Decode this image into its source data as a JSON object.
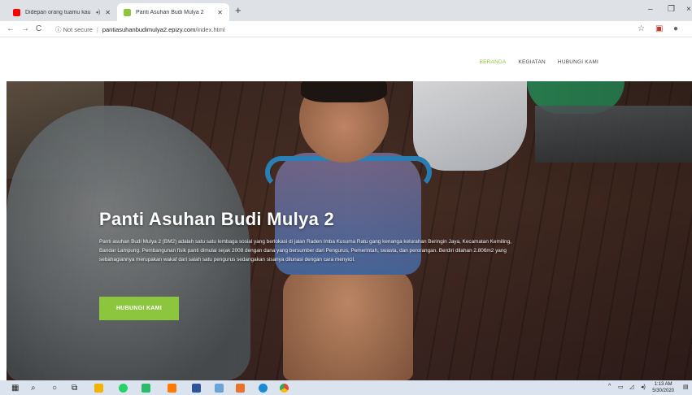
{
  "browser": {
    "tabs": [
      {
        "title": "Didepan orang tuamu kau m",
        "active": false,
        "favicon_color": "#ff0000"
      },
      {
        "title": "Panti Asuhan Budi Mulya 2",
        "active": true,
        "favicon_color": "#8cc63f"
      }
    ],
    "new_tab_icon": "+",
    "window_controls": [
      "–",
      "❐",
      "×"
    ],
    "nav": {
      "back": "←",
      "forward": "→",
      "reload": "C"
    },
    "security": "Not secure",
    "url_host": "pantiasuhanbudimulya2.epizy.com",
    "url_path": "/index.html",
    "toolbar_icons": [
      "star-icon",
      "extension-icon",
      "profile-icon"
    ]
  },
  "site": {
    "nav_items": [
      {
        "label": "BERANDA",
        "active": true
      },
      {
        "label": "KEGIATAN",
        "active": false
      },
      {
        "label": "HUBUNGI KAMI",
        "active": false
      }
    ],
    "accent_color": "#8cc63f"
  },
  "hero": {
    "title": "Panti Asuhan Budi Mulya 2",
    "description": "Panti asuhan Budi Mulya 2 (BM2) adalah satu satu lembaga sosial yang berlokasi di jalan Raden Imba Kusuma Ratu gang kenanga kelurahan Beringin Jaya, Kecamatan Kemiling, Bandar Lampung. Pembangunan fisik panti dimulai sejak 2008 dengan dana yang bersumber dari Pengurus, Pemerintah, swasta, dan perorangan. Berdiri dilahan 2.806m2 yang sebahagiannya merupakan wakaf dari salah satu pengurus sedangakan sisanya dilunasi dengan cara menyicil.",
    "button_label": "HUBUNGI KAMI"
  },
  "taskbar": {
    "clock_time": "1:13 AM",
    "clock_date": "5/30/2020"
  }
}
